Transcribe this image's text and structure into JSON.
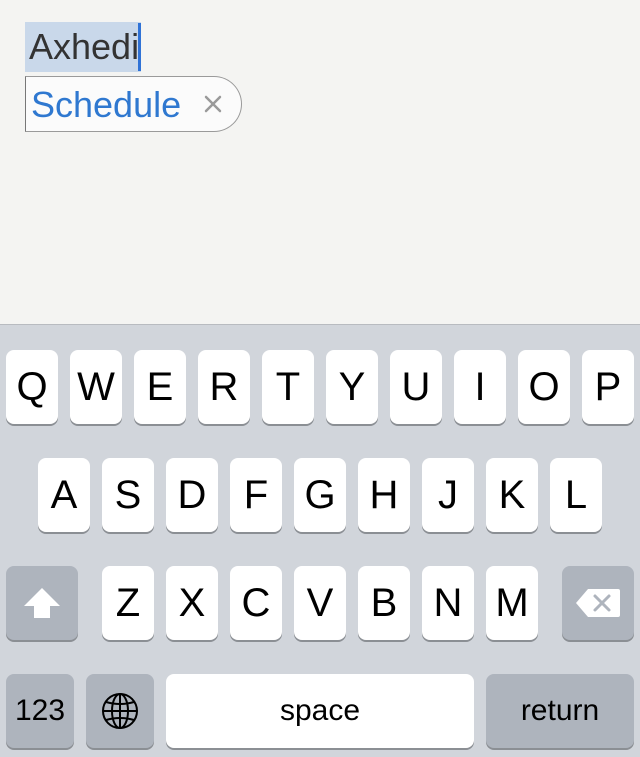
{
  "note": {
    "title_text": "Axhedi",
    "tag": {
      "label": "Schedule"
    }
  },
  "keyboard": {
    "row1": [
      "Q",
      "W",
      "E",
      "R",
      "T",
      "Y",
      "U",
      "I",
      "O",
      "P"
    ],
    "row2": [
      "A",
      "S",
      "D",
      "F",
      "G",
      "H",
      "J",
      "K",
      "L"
    ],
    "row3": [
      "Z",
      "X",
      "C",
      "V",
      "B",
      "N",
      "M"
    ],
    "numbers_label": "123",
    "space_label": "space",
    "return_label": "return",
    "icons": {
      "shift": "shift-arrow-icon",
      "delete": "backspace-icon",
      "globe": "globe-icon",
      "tag_remove": "close-icon"
    },
    "colors": {
      "background": "#d1d5db",
      "key": "#ffffff",
      "special_key": "#aeb4bd",
      "selection": "#c9d8ea",
      "tag_text": "#2f78d0"
    }
  }
}
